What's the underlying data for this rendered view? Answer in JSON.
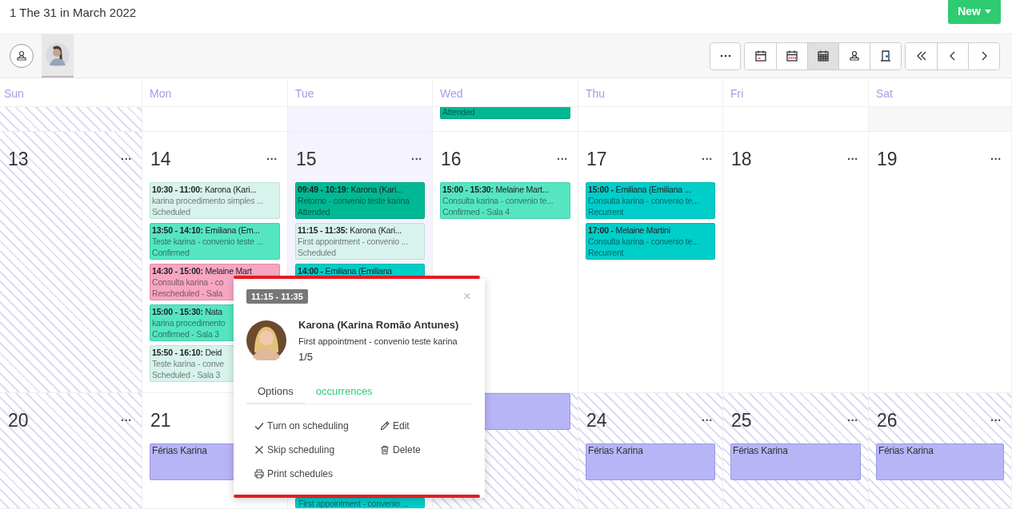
{
  "title": "1 The 31 in March 2022",
  "new_button": {
    "label": "New"
  },
  "filters": [
    {
      "kind": "all",
      "selected": false
    },
    {
      "kind": "avatar",
      "selected": true
    }
  ],
  "more_button": {
    "kind": "more"
  },
  "view_buttons": [
    {
      "kind": "day",
      "selected": false
    },
    {
      "kind": "week",
      "selected": false
    },
    {
      "kind": "month",
      "selected": true
    },
    {
      "kind": "professional",
      "selected": false
    },
    {
      "kind": "room",
      "selected": false
    }
  ],
  "nav_buttons": [
    {
      "kind": "first"
    },
    {
      "kind": "prev"
    },
    {
      "kind": "next"
    }
  ],
  "weekdays": [
    "Sun",
    "Mon",
    "Tue",
    "Wed",
    "Thu",
    "Fri",
    "Sat"
  ],
  "weeks": [
    {
      "days": [
        {
          "kind": "striped"
        },
        {
          "kind": "plain"
        },
        {
          "kind": "today"
        },
        {
          "kind": "plain",
          "events": [
            {
              "kind": "attended",
              "status_text": "Attended",
              "cut_top": true
            }
          ]
        },
        {
          "kind": "plain"
        },
        {
          "kind": "plain"
        },
        {
          "kind": "grey"
        }
      ]
    },
    {
      "days": [
        {
          "kind": "striped",
          "day": "13",
          "more": "···"
        },
        {
          "kind": "plain",
          "day": "14",
          "more": "···",
          "events": [
            {
              "kind": "scheduled",
              "title": "**10:30 - 11:00:** Karona (Kari...",
              "detail": "karina procedimento simples ...",
              "status_text": "Scheduled"
            },
            {
              "kind": "confirmed",
              "title": "**13:50 - 14:10:** Emiliana (Em...",
              "detail": "Teste karina - convenio teste ...",
              "status_text": "Confirmed"
            },
            {
              "kind": "rescheduled",
              "title": "**14:30 - 15:00:** Melaine Mart",
              "detail": "Consulta karina - co",
              "status_text": "Rescheduled - Sala"
            },
            {
              "kind": "confirmed",
              "title": "**15:00 - 15:30:** Nata",
              "detail": "karina procedimento",
              "status_text": "Confirmed - Sala 3"
            },
            {
              "kind": "scheduled",
              "title": "**15:50 - 16:10:** Deid",
              "detail": "Teste karina - conve",
              "status_text": "Scheduled - Sala 3"
            }
          ]
        },
        {
          "kind": "today",
          "day": "15",
          "more": "···",
          "events": [
            {
              "kind": "attended",
              "title": "**09:49 - 10:19:** Karona (Kari...",
              "detail": "Retorno - convenio teste karina",
              "status_text": "Attended"
            },
            {
              "kind": "scheduled",
              "title": "**11:15 - 11:35:** Karona (Kari...",
              "detail": "First appointment - convenio ...",
              "status_text": "Scheduled"
            },
            {
              "kind": "recurrent",
              "title": "**14:00 -** Emiliana (Emiliana"
            }
          ]
        },
        {
          "kind": "plain",
          "day": "16",
          "more": "···",
          "events": [
            {
              "kind": "confirmed",
              "title": "**15:00 - 15:30:** Melaine Mart...",
              "detail": "Consulta karina - convenio te...",
              "status_text": "Confirmed - Sala 4"
            }
          ]
        },
        {
          "kind": "plain",
          "day": "17",
          "more": "···",
          "events": [
            {
              "kind": "recurrent",
              "title": "**15:00 -** Emiliana (Emiliana ...",
              "detail": "Consulta karina - convenio te...",
              "status_text": "Recurrent"
            },
            {
              "kind": "recurrent",
              "title": "**17:00 -** Melaine Martini",
              "detail": "Consulta karina - convenio te...",
              "status_text": "Recurrent"
            }
          ]
        },
        {
          "kind": "plain",
          "day": "18",
          "more": "···"
        },
        {
          "kind": "plain",
          "day": "19",
          "more": "···"
        }
      ]
    },
    {
      "days": [
        {
          "kind": "striped",
          "day": "20",
          "more": "···"
        },
        {
          "kind": "plain",
          "day": "21",
          "events": [
            {
              "kind": "vacation",
              "title": "Férias Karina"
            }
          ]
        },
        {
          "kind": "plain",
          "events": [
            {
              "kind": "recurrent",
              "detail": "First appointment - convenio ...",
              "pinned_bottom": true
            }
          ]
        },
        {
          "kind": "striped",
          "events": [
            {
              "kind": "vacation"
            }
          ]
        },
        {
          "kind": "striped",
          "day": "24",
          "more": "···",
          "events": [
            {
              "kind": "vacation",
              "title": "Férias Karina"
            }
          ]
        },
        {
          "kind": "striped",
          "day": "25",
          "more": "···",
          "events": [
            {
              "kind": "vacation",
              "title": "Férias Karina"
            }
          ]
        },
        {
          "kind": "striped",
          "day": "26",
          "more": "···",
          "events": [
            {
              "kind": "vacation",
              "title": "Férias Karina"
            }
          ]
        }
      ]
    }
  ],
  "popover": {
    "time": "11:15 - 11:35",
    "close": "×",
    "name": "Karona (Karina Romão Antunes)",
    "detail": "First appointment - convenio teste karina",
    "count": "1/5",
    "tabs": [
      {
        "label": "Options",
        "selected": true
      },
      {
        "label": "occurrences",
        "selected": false
      }
    ],
    "actions": [
      {
        "kind": "check",
        "label": "Turn on scheduling"
      },
      {
        "kind": "edit",
        "label": "Edit"
      },
      {
        "kind": "skip",
        "label": "Skip scheduling"
      },
      {
        "kind": "delete",
        "label": "Delete"
      },
      {
        "kind": "print",
        "label": "Print schedules"
      }
    ]
  }
}
